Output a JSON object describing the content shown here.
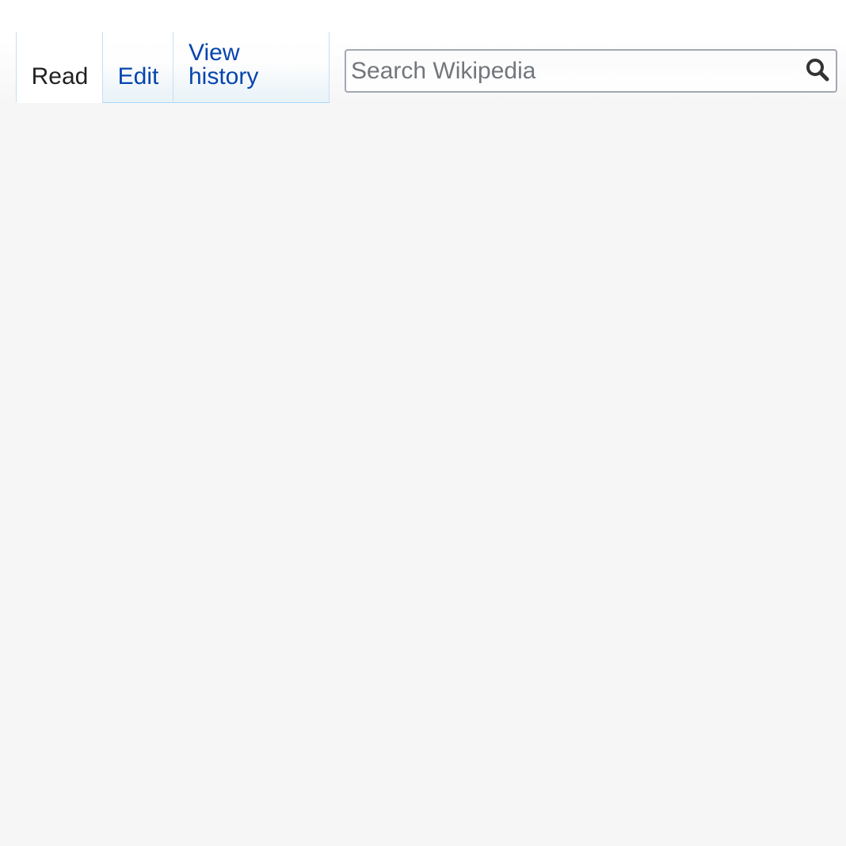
{
  "tabs": [
    {
      "label": "Read",
      "selected": true
    },
    {
      "label": "Edit",
      "selected": false
    },
    {
      "label": "View history",
      "selected": false
    }
  ],
  "search": {
    "placeholder": "Search Wikipedia",
    "value": "",
    "icon": "search-icon"
  },
  "colors": {
    "link": "#0645ad",
    "text": "#202122",
    "background": "#f6f6f6",
    "tab_border": "#a7d7f9",
    "input_border": "#a2a9b1",
    "placeholder": "#72777d",
    "icon": "#202122"
  }
}
